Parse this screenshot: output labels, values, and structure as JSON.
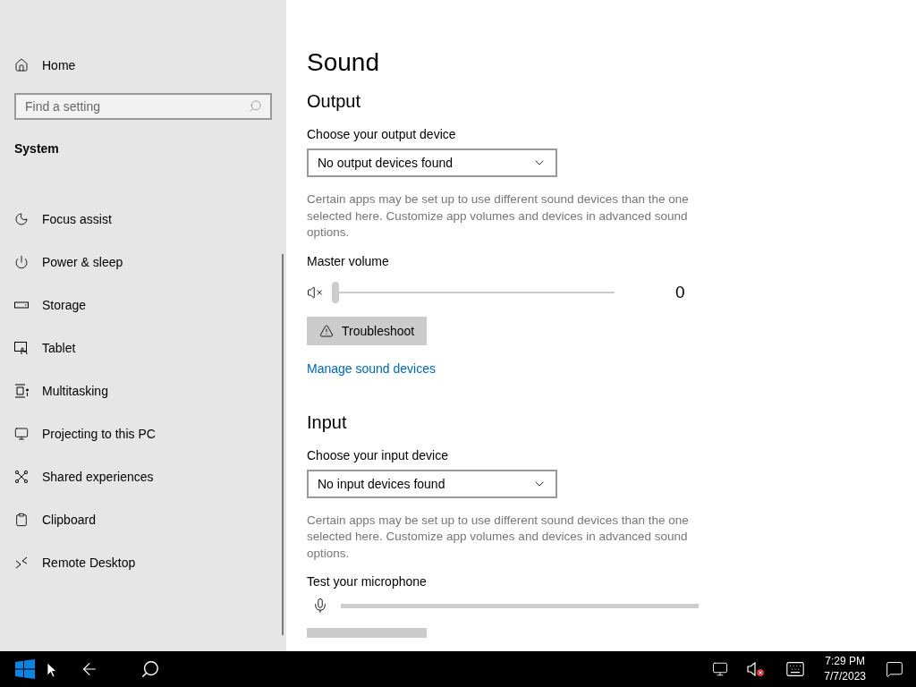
{
  "sidebar": {
    "home": "Home",
    "search": {
      "placeholder": "Find a setting"
    },
    "section": "System",
    "items": [
      {
        "label": "Focus assist"
      },
      {
        "label": "Power & sleep"
      },
      {
        "label": "Storage"
      },
      {
        "label": "Tablet"
      },
      {
        "label": "Multitasking"
      },
      {
        "label": "Projecting to this PC"
      },
      {
        "label": "Shared experiences"
      },
      {
        "label": "Clipboard"
      },
      {
        "label": "Remote Desktop"
      }
    ]
  },
  "main": {
    "title": "Sound",
    "output": {
      "heading": "Output",
      "device_label": "Choose your output device",
      "device": "No output devices found",
      "description": "Certain apps may be set up to use different sound devices than the one selected here. Customize app volumes and devices in advanced sound options.",
      "volume_label": "Master volume",
      "volume": {
        "level": 0,
        "reading": "0"
      },
      "troubleshoot": "Troubleshoot",
      "manage_link": "Manage sound devices"
    },
    "input": {
      "heading": "Input",
      "device_label": "Choose your input device",
      "device": "No input devices found",
      "description": "Certain apps may be set up to use different sound devices than the one selected here. Customize app volumes and devices in advanced sound options.",
      "test_label": "Test your microphone",
      "meter": {
        "level": 0
      }
    }
  },
  "taskbar": {
    "time": "7:29 PM",
    "date": "7/7/2023"
  }
}
